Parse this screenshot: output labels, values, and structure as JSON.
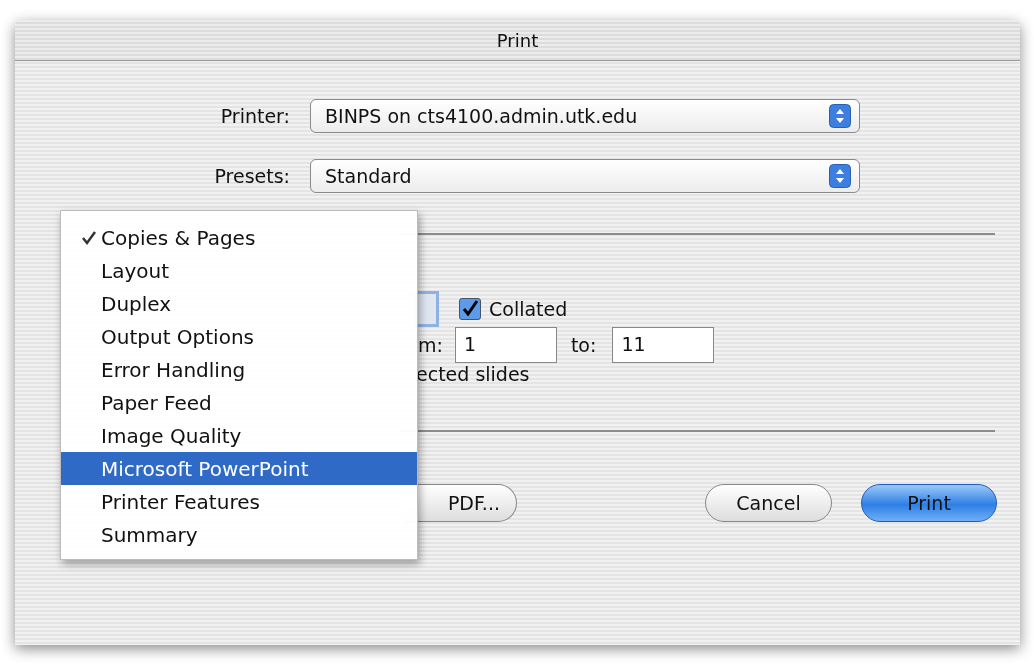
{
  "window": {
    "title": "Print"
  },
  "printer": {
    "label": "Printer:",
    "value": "BINPS on cts4100.admin.utk.edu"
  },
  "presets": {
    "label": "Presets:",
    "value": "Standard"
  },
  "collated": {
    "label": "Collated",
    "checked": true
  },
  "range": {
    "from_label": "m:",
    "from_value": "1",
    "to_label": "to:",
    "to_value": "11",
    "selection_label": "ected slides"
  },
  "panel_menu": [
    {
      "label": "Copies & Pages",
      "checked": true,
      "selected": false
    },
    {
      "label": "Layout",
      "checked": false,
      "selected": false
    },
    {
      "label": "Duplex",
      "checked": false,
      "selected": false
    },
    {
      "label": "Output Options",
      "checked": false,
      "selected": false
    },
    {
      "label": "Error Handling",
      "checked": false,
      "selected": false
    },
    {
      "label": "Paper Feed",
      "checked": false,
      "selected": false
    },
    {
      "label": "Image Quality",
      "checked": false,
      "selected": false
    },
    {
      "label": "Microsoft PowerPoint",
      "checked": false,
      "selected": true
    },
    {
      "label": "Printer Features",
      "checked": false,
      "selected": false
    },
    {
      "label": "Summary",
      "checked": false,
      "selected": false
    }
  ],
  "buttons": [
    {
      "label": "PDF...",
      "kind": "partial"
    },
    {
      "label": "Cancel",
      "kind": "normal"
    },
    {
      "label": "Print",
      "kind": "default"
    }
  ]
}
